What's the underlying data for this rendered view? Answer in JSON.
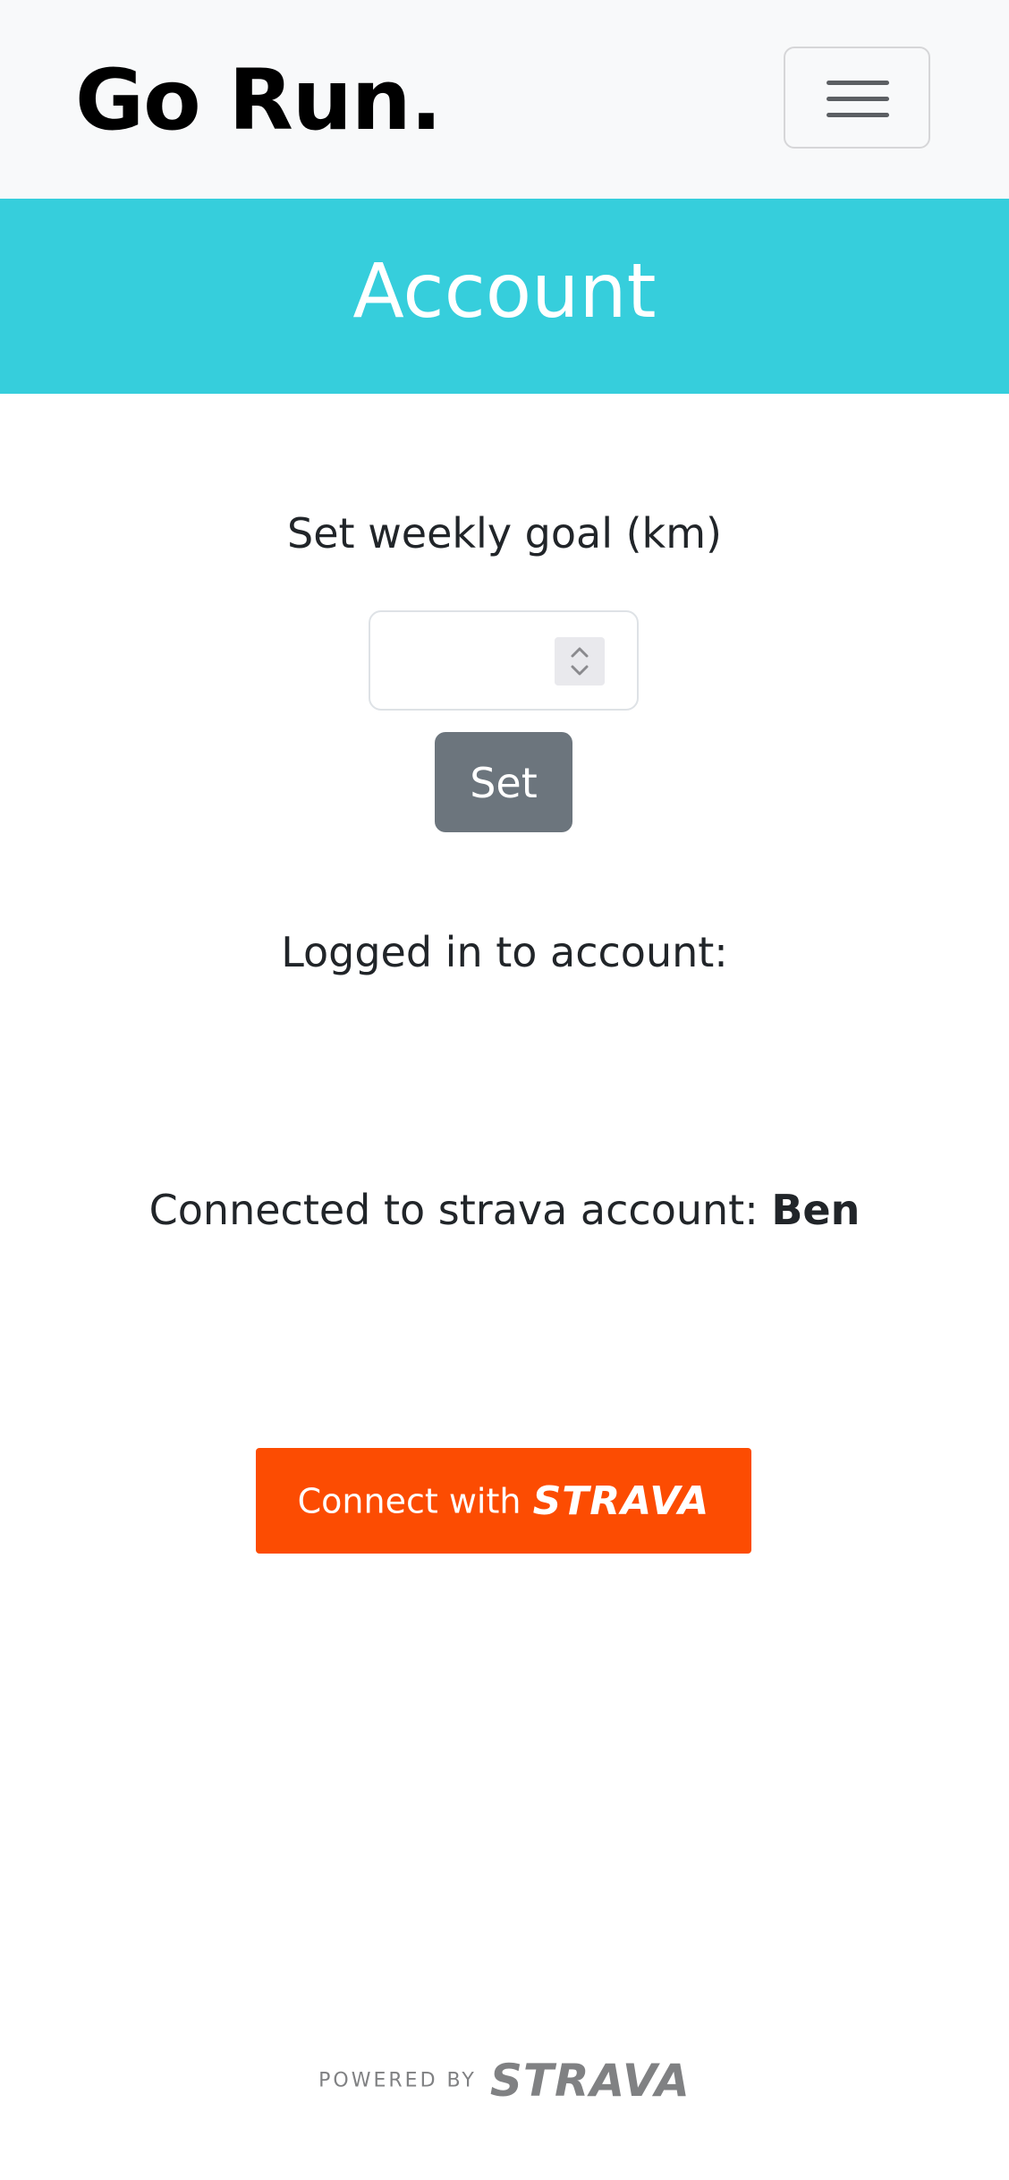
{
  "navbar": {
    "brand": "Go Run.",
    "toggler_icon": "hamburger-menu-icon"
  },
  "hero": {
    "title": "Account"
  },
  "goal": {
    "label": "Set weekly goal (km)",
    "input_value": "",
    "input_placeholder": "",
    "spinner_icon": "number-spinner-icon",
    "set_button": "Set"
  },
  "account": {
    "logged_in_label": "Logged in to account:",
    "logged_in_value": "",
    "strava_label": "Connected to strava account: ",
    "strava_name": "Ben"
  },
  "connect": {
    "text": "Connect with",
    "logo": "STRAVA"
  },
  "footer": {
    "powered_by": "POWERED BY",
    "logo": "STRAVA"
  },
  "colors": {
    "navbar_bg": "#f8f9fa",
    "hero_bg": "#36cedc",
    "set_button_bg": "#6c757d",
    "strava_orange": "#fc4c02",
    "footer_gray": "#808183"
  }
}
